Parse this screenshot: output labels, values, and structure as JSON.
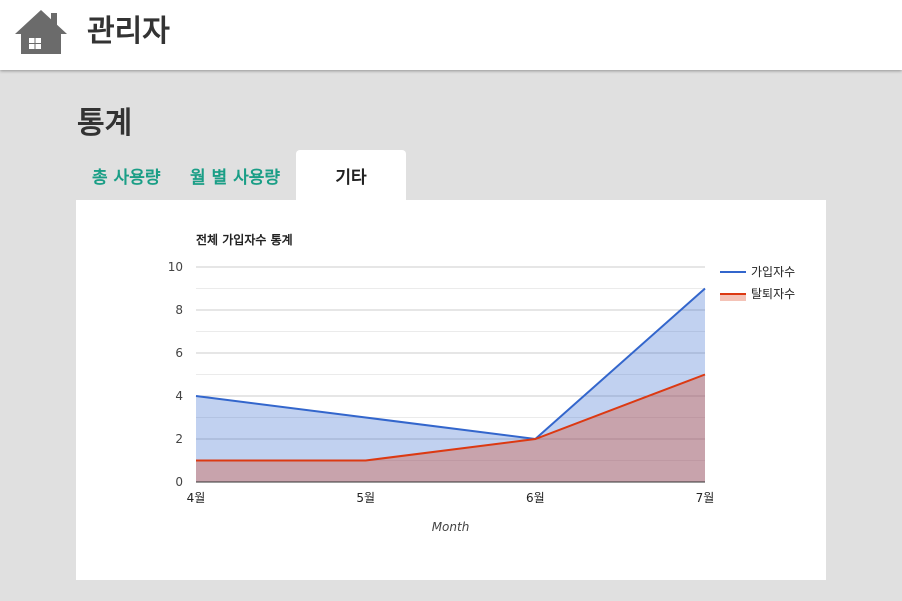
{
  "header": {
    "title": "관리자",
    "home_icon": "home-icon"
  },
  "page": {
    "title": "통계"
  },
  "tabs": [
    {
      "label": "총 사용량",
      "active": false
    },
    {
      "label": "월 별 사용량",
      "active": false
    },
    {
      "label": "기타",
      "active": true
    }
  ],
  "colors": {
    "accent": "#1a9e86",
    "series_joined": "#3366cc",
    "series_left": "#dc3912"
  },
  "chart_data": {
    "type": "area",
    "title": "전체 가입자수 통계",
    "xlabel": "Month",
    "ylabel": "",
    "categories": [
      "4월",
      "5월",
      "6월",
      "7월"
    ],
    "ylim": [
      0,
      10
    ],
    "yticks": [
      "0",
      "2",
      "4",
      "6",
      "8",
      "10"
    ],
    "series": [
      {
        "name": "가입자수",
        "values": [
          4,
          3,
          2,
          9
        ]
      },
      {
        "name": "탈퇴자수",
        "values": [
          1,
          1,
          2,
          5
        ]
      }
    ],
    "legend": "right",
    "grid": true
  }
}
